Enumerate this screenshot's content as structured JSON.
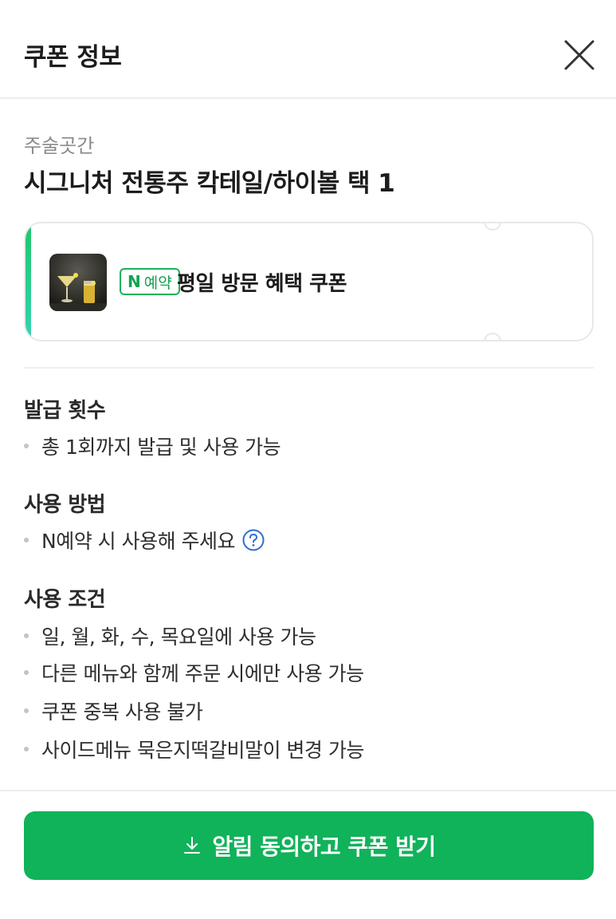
{
  "header": {
    "title": "쿠폰 정보"
  },
  "store": {
    "name": "주술곳간"
  },
  "coupon": {
    "title": "시그니처 전통주 칵테일/하이볼 택 1",
    "badge_mark": "N",
    "badge_label": "예약",
    "name": "평일 방문 혜택 쿠폰",
    "accent_color": "#1fc66a"
  },
  "sections": {
    "issue": {
      "title": "발급 횟수",
      "items": [
        "총 1회까지 발급 및 사용 가능"
      ]
    },
    "usage": {
      "title": "사용 방법",
      "items": [
        "N예약 시 사용해 주세요"
      ]
    },
    "conditions": {
      "title": "사용 조건",
      "items": [
        "일, 월, 화, 수, 목요일에 사용 가능",
        "다른 메뉴와 함께 주문 시에만 사용 가능",
        "쿠폰 중복 사용 불가",
        "사이드메뉴 묵은지떡갈비말이 변경 가능"
      ]
    }
  },
  "footer": {
    "button_label": "알림 동의하고 쿠폰 받기",
    "button_color": "#10b25a"
  },
  "icons": {
    "close": "close-icon",
    "help": "question-circle-icon",
    "download": "download-icon"
  }
}
